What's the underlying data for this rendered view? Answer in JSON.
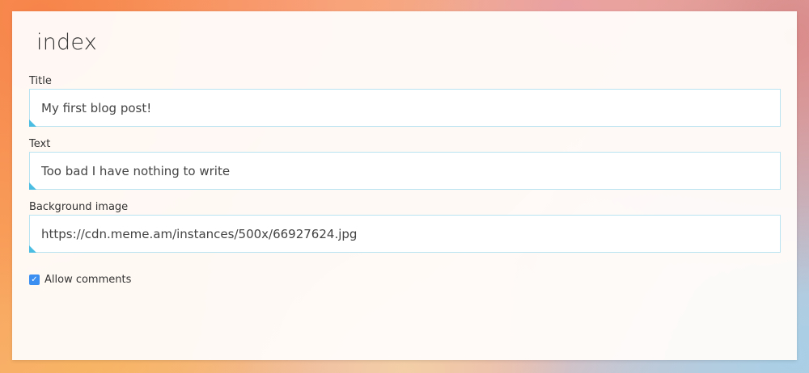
{
  "page": {
    "title": "index"
  },
  "form": {
    "title_field": {
      "label": "Title",
      "value": "My first blog post!"
    },
    "text_field": {
      "label": "Text",
      "value": "Too bad I have nothing to write"
    },
    "background_field": {
      "label": "Background image",
      "value": "https://cdn.meme.am/instances/500x/66927624.jpg"
    },
    "allow_comments": {
      "label": "Allow comments",
      "checked": true,
      "check_glyph": "✓"
    }
  },
  "colors": {
    "accent": "#4bbde3",
    "input_border": "#b9e3f0",
    "checkbox": "#3b8ff0"
  }
}
